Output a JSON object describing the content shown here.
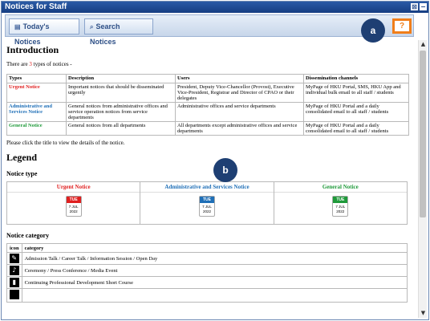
{
  "window": {
    "title": "Notices for Staff"
  },
  "tabs": [
    {
      "label": "Today's Notices",
      "icon": "calendar-icon"
    },
    {
      "label": "Search Notices",
      "icon": "search-icon"
    }
  ],
  "help_label": "?",
  "bubbles": {
    "a": "a",
    "b": "b"
  },
  "intro": {
    "heading": "Introduction",
    "text_before": "There are ",
    "count": "3",
    "text_after": " types of notices -"
  },
  "types_table": {
    "headers": [
      "Types",
      "Description",
      "Users",
      "Dissemination channels"
    ],
    "rows": [
      {
        "type": "Urgent Notice",
        "desc": "Important notices that should be disseminated urgently",
        "users": "President, Deputy Vice-Chancellor (Provost), Executive Vice-President, Registrar and Director of CPAO or their delegates",
        "channels": "MyPage of HKU Portal, SMS, HKU App and individual bulk email to all staff / students"
      },
      {
        "type": "Administrative and Services Notice",
        "desc": "General notices from administrative offices and service operation notices from service departments",
        "users": "Administrative offices and service departments",
        "channels": "MyPage of HKU Portal and a daily consolidated email to all staff / students"
      },
      {
        "type": "General Notice",
        "desc": "General notices from all departments",
        "users": "All departments except administrative offices and service departments",
        "channels": "MyPage of HKU Portal and a daily consolidated email to all staff / students"
      }
    ]
  },
  "click_hint": "Please click the title to view the details of the notice.",
  "legend": {
    "heading": "Legend",
    "notice_type_heading": "Notice type",
    "types": [
      {
        "label": "Urgent Notice",
        "color": "#e02020",
        "day": "TUE",
        "date": "7 JUL",
        "year": "2022"
      },
      {
        "label": "Administrative and Services Notice",
        "color": "#1f6fb7",
        "day": "TUE",
        "date": "7 JUL",
        "year": "2022"
      },
      {
        "label": "General Notice",
        "color": "#1f9a3a",
        "day": "TUE",
        "date": "7 JUL",
        "year": "2022"
      }
    ],
    "category_heading": "Notice category",
    "category_headers": [
      "icon",
      "category"
    ],
    "categories": [
      {
        "icon": "talk-icon",
        "label": "Admission Talk / Career Talk / Information Session / Open Day"
      },
      {
        "icon": "ceremony-icon",
        "label": "Ceremony / Press Conference / Media Event"
      },
      {
        "icon": "book-icon",
        "label": "Continuing Professional Development Short Course"
      }
    ]
  }
}
